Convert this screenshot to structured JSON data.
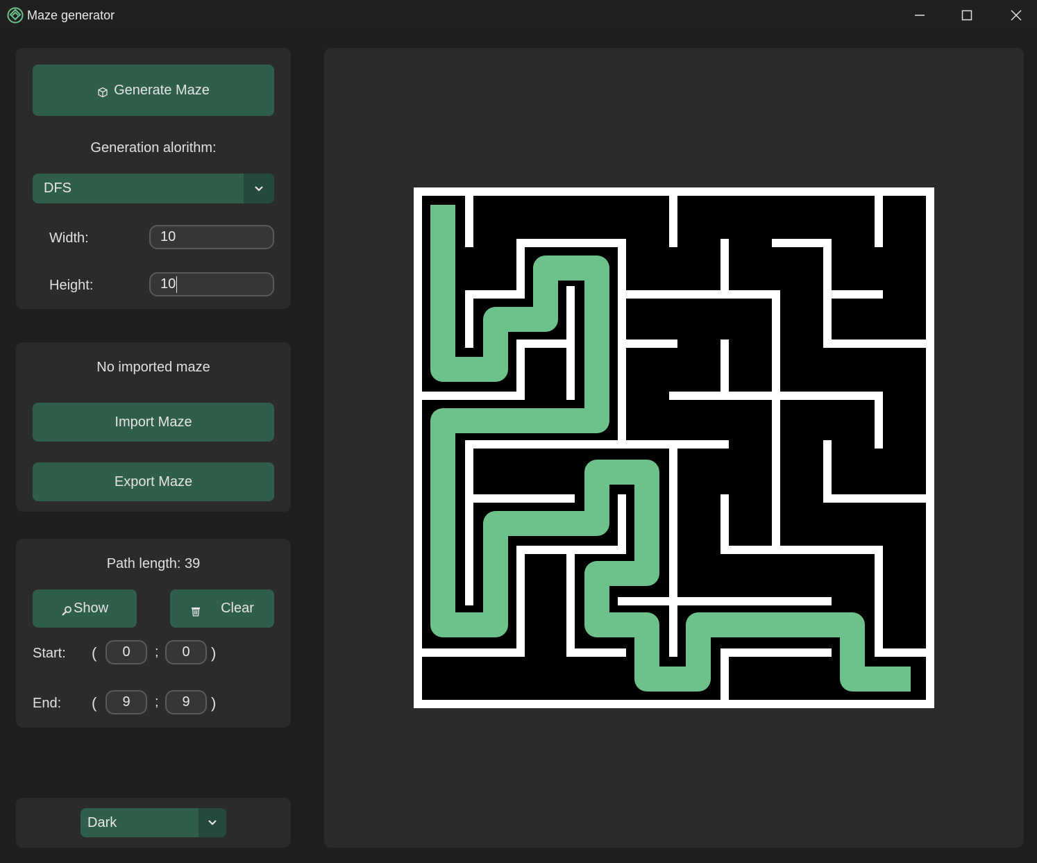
{
  "window": {
    "title": "Maze generator",
    "icon": "maze-app-icon",
    "controls": [
      "minimize-icon",
      "maximize-icon",
      "close-icon"
    ]
  },
  "generation": {
    "generate_label": "Generate Maze",
    "generate_icon": "cube-icon",
    "algorithm_label": "Generation alorithm:",
    "algorithm_value": "DFS",
    "width_label": "Width:",
    "width_value": "10",
    "height_label": "Height:",
    "height_value": "10"
  },
  "import_export": {
    "status": "No imported maze",
    "import_label": "Import Maze",
    "export_label": "Export Maze"
  },
  "path": {
    "length_text": "Path length: 39",
    "show_label": "Show",
    "show_icon": "magnifier-icon",
    "clear_label": "Clear",
    "clear_icon": "trash-icon",
    "start_label": "Start:",
    "start_x": "0",
    "start_y": "0",
    "end_label": "End:",
    "end_x": "9",
    "end_y": "9",
    "open_paren": "(",
    "separator": ";",
    "close_paren": ")"
  },
  "appearance": {
    "theme_value": "Dark"
  },
  "colors": {
    "accent": "#2f5f4b",
    "path": "#6cc28a",
    "maze_wall": "#ffffff",
    "maze_bg": "#000000"
  }
}
